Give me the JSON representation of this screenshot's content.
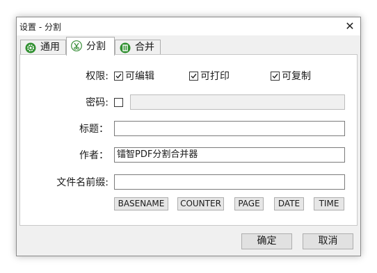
{
  "window": {
    "title": "设置 - 分割",
    "close_glyph": "✕"
  },
  "tabs": [
    {
      "label": "通用",
      "icon": "gear-icon"
    },
    {
      "label": "分割",
      "icon": "scissors-icon",
      "active": true
    },
    {
      "label": "合并",
      "icon": "merge-icon"
    }
  ],
  "permissions": {
    "label": "权限:",
    "options": [
      {
        "label": "可编辑",
        "checked": true
      },
      {
        "label": "可打印",
        "checked": true
      },
      {
        "label": "可复制",
        "checked": true
      }
    ]
  },
  "password": {
    "label": "密码:",
    "checked": false,
    "value": ""
  },
  "title_field": {
    "label": "标题：",
    "value": ""
  },
  "author_field": {
    "label": "作者：",
    "value": "镭智PDF分割合并器"
  },
  "filename_prefix": {
    "label": "文件名前缀:",
    "value": ""
  },
  "tokens": [
    "BASENAME",
    "COUNTER",
    "PAGE",
    "DATE",
    "TIME"
  ],
  "buttons": {
    "ok": "确定",
    "cancel": "取消"
  }
}
